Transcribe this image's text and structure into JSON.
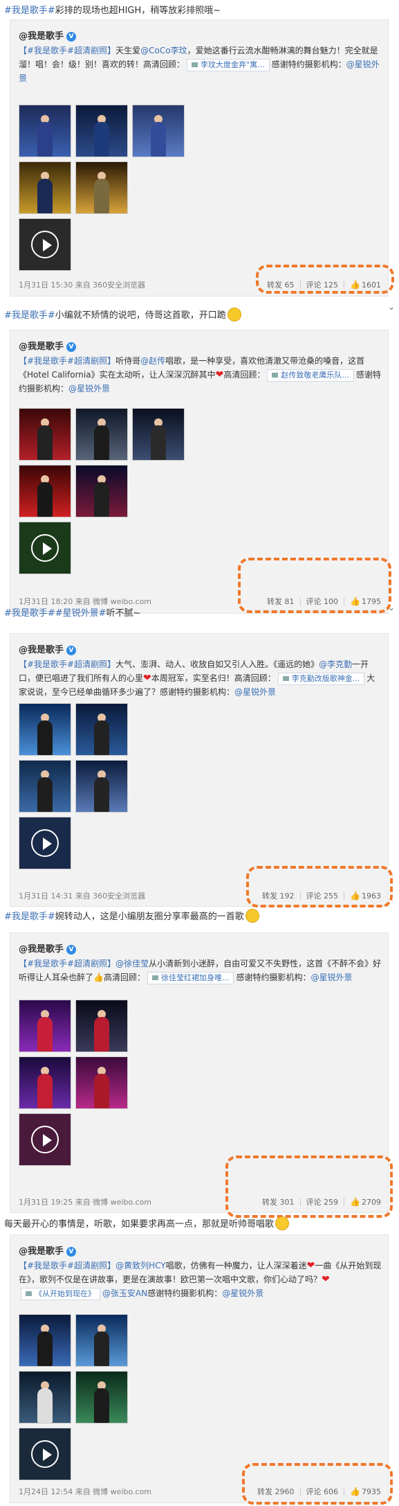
{
  "posts": [
    {
      "caption_tag": "#我是歌手#",
      "caption_text": "彩排的现场也超HIGH，稍等放彩排照哦~",
      "author": "@我是歌手",
      "body_tags": "【#我是歌手#超清剧照】",
      "body_a": "天生爱",
      "mention": "@CoCo李玟",
      "body_b": "，爱她这番行云流水酣畅淋漓的舞台魅力！完全就是溜！唱！会！级！别！喜欢的转！高清回顾：",
      "video_chip": "李玟大度金弃\"寓...",
      "body_c": "感谢特约摄影机构：",
      "studio": "@星锐外景",
      "time": "1月31日 15:30 来自 360安全浏览器",
      "repost": "转发 65",
      "comment": "评论 125",
      "like": "1601"
    },
    {
      "caption_tag": "#我是歌手#",
      "caption_text": "小编就不矫情的说吧，侍哥这首歌，开口跪",
      "author": "@我是歌手",
      "body_tags": "【#我是歌手#超清剧照】",
      "body_a": "听侍哥",
      "mention": "@赵传",
      "body_b": "唱歌，是一种享受，喜欢他清澈又带沧桑的嗓音，这首《Hotel California》实在太动听，让人深深沉醉其中",
      "body_b2": "高清回顾：",
      "video_chip": "赵传致敬老鹰乐队...",
      "body_c": "感谢特约摄影机构：",
      "studio": "@星锐外景",
      "time": "1月31日 18:20 来自 微博 weibo.com",
      "repost": "转发 81",
      "comment": "评论 100",
      "like": "1795"
    },
    {
      "caption_tag": "#我是歌手##星锐外景#",
      "caption_text": "听不腻~",
      "author": "@我是歌手",
      "body_tags": "【#我是歌手#超清剧照】",
      "body_a": "大气、澎湃、动人、收放自如又引人入胜。《遥远的她》",
      "mention": "@李克勤",
      "body_b": "一开口，便已唱进了我们所有人的心里",
      "body_b2": "本周冠军，实至名归！高清回顾：",
      "video_chip": "李克勤改版歌神金...",
      "body_c": "大家说说，至今已经单曲循环多少遍了？感谢特约摄影机构：",
      "studio": "@星锐外景",
      "time": "1月31日 14:31 来自 360安全浏览器",
      "repost": "转发 192",
      "comment": "评论 255",
      "like": "1963"
    },
    {
      "caption_tag": "#我是歌手#",
      "caption_text": "婉转动人，这是小编朋友圈分享率最高的一首歌",
      "author": "@我是歌手",
      "body_tags": "【#我是歌手#超清剧照】",
      "body_a": "",
      "mention": "@徐佳莹",
      "body_b": "从小清新到小迷醉，自由可爱又不失野性，这首《不醉不会》好听得让人耳朵也醉了",
      "body_b2": "高清回顾：",
      "video_chip": "徐佳莹红裙加身唯...",
      "body_c": "感谢特约摄影机构：",
      "studio": "@星锐外景",
      "time": "1月31日 19:25 来自 微博 weibo.com",
      "repost": "转发 301",
      "comment": "评论 259",
      "like": "2709"
    },
    {
      "caption_tag": "",
      "caption_text": "每天最开心的事情是，听歌，如果要求再高一点，那就是听帅哥唱歌",
      "author": "@我是歌手",
      "body_tags": "【#我是歌手#超清剧照】",
      "body_a": "",
      "mention": "@黄致列HCY",
      "body_b": "唱歌，仿佛有一种魔力，让人深深着迷",
      "body_b2": "一曲《从开始到现在》，歌列不仅是在讲故事，更是在演故事！欧巴第一次唱中文歌，你们心动了吗？",
      "video_chip": "《从开始到现在》",
      "mention2": "@张玉安AN",
      "body_c": "感谢特约摄影机构：",
      "studio": "@星锐外景",
      "time": "1月24日 12:54 来自 微博 weibo.com",
      "repost": "转发 2960",
      "comment": "评论 606",
      "like": "7935"
    }
  ],
  "colors": {
    "link": "#3b6fb5",
    "highlight": "#f0782a",
    "heart": "#e3232a",
    "card_bg": "#f2f2f2"
  },
  "icons": {
    "verified": "blue-v-badge",
    "like": "thumbs-up-icon",
    "video": "play-icon",
    "expand": "chevron-down-icon"
  }
}
